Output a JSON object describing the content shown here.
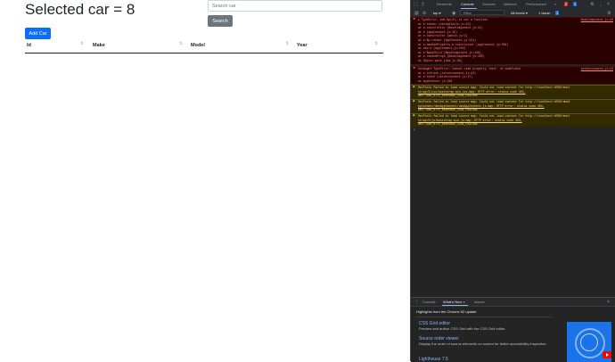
{
  "app": {
    "title": "Selected car = 8",
    "search_placeholder": "Search car",
    "search_button": "Search",
    "add_button": "Add Car",
    "columns": [
      "Id",
      "Make",
      "Model",
      "Year"
    ],
    "sort_icon": "sort-arrows-icon"
  },
  "devtools": {
    "tabs": [
      "Elements",
      "Console",
      "Sources",
      "Network",
      "Performance",
      "»"
    ],
    "active_tab": "Console",
    "error_count": "2",
    "info_count": "1",
    "toolbar": {
      "context": "top ▾",
      "filter_placeholder": "Filter",
      "levels": "All levels ▾",
      "issues": "1 Issue:",
      "issues_count": "1"
    },
    "messages": [
      {
        "level": "error",
        "lines": [
          "▸ TypeError: dom.$p(el) is not a function",
          "    at e.render (carsdetails.js:15)",
          "    at e.constructor (BaseComponent.js:21)",
          "    at e (appConnect.js:15)",
          "    at e.constructor (match.js:5)",
          "    at e.$p.render (appConnect.js:154)",
          "    at e.hasOwnProperty.e.constructor (appConnect.js:364)",
          "    at new e (appConnect.js:104)",
          "    at e.$addChild (BaseComponent.js:238)",
          "    at e.randomProps (BaseComponent.js:265)",
          "    at Object.walk (dom.js:38)"
        ],
        "source": "BaseComponent.js:20"
      },
      {
        "level": "error",
        "lines": [
          "Uncaught TypeError: Cannot read property 'omit' of undefined",
          "    at e.refresh (serverconnect.js:43)",
          "    at e.fetch (serverconnect.js:27)",
          "    at appConnect.js:338"
        ],
        "source": "serverconnect.js:43"
      },
      {
        "level": "warning",
        "lines": [
          "DevTools failed to load source map: Could not load content for http://localhost:8500/boot",
          "strap/5/css/bootstrap.min.css.map: HTTP error: status code 404,",
          "net::ERR_HTTP_RESPONSE_CODE_FAILURE"
        ]
      },
      {
        "level": "warning",
        "lines": [
          "DevTools failed to load source map: Could not load content for http://localhost:8500/dmxA",
          "ppConnect/dmxAppConnect/dmxAppConnect.js.map: HTTP error: status code 404,",
          "net::ERR_HTTP_RESPONSE_CODE_FAILURE"
        ]
      },
      {
        "level": "warning",
        "lines": [
          "DevTools failed to load source map: Could not load content for http://localhost:8500/boot",
          "strap/5/js/bootstrap.min.js.map: HTTP error: status code 404,",
          "net::ERR_HTTP_RESPONSE_CODE_FAILURE"
        ]
      }
    ],
    "drawer": {
      "tabs": [
        "Console",
        "What's New ×",
        "Issues"
      ],
      "highlights": "Highlights from the Chrome 92 update",
      "features": [
        {
          "title": "CSS Grid editor",
          "desc": "Preview and author CSS Grid with the CSS Grid editor."
        },
        {
          "title": "Source order viewer",
          "desc": "Display the order of source elements on screen for better accessibility inspection."
        },
        {
          "title": "Lighthouse 7.5",
          "desc": ""
        }
      ]
    }
  }
}
